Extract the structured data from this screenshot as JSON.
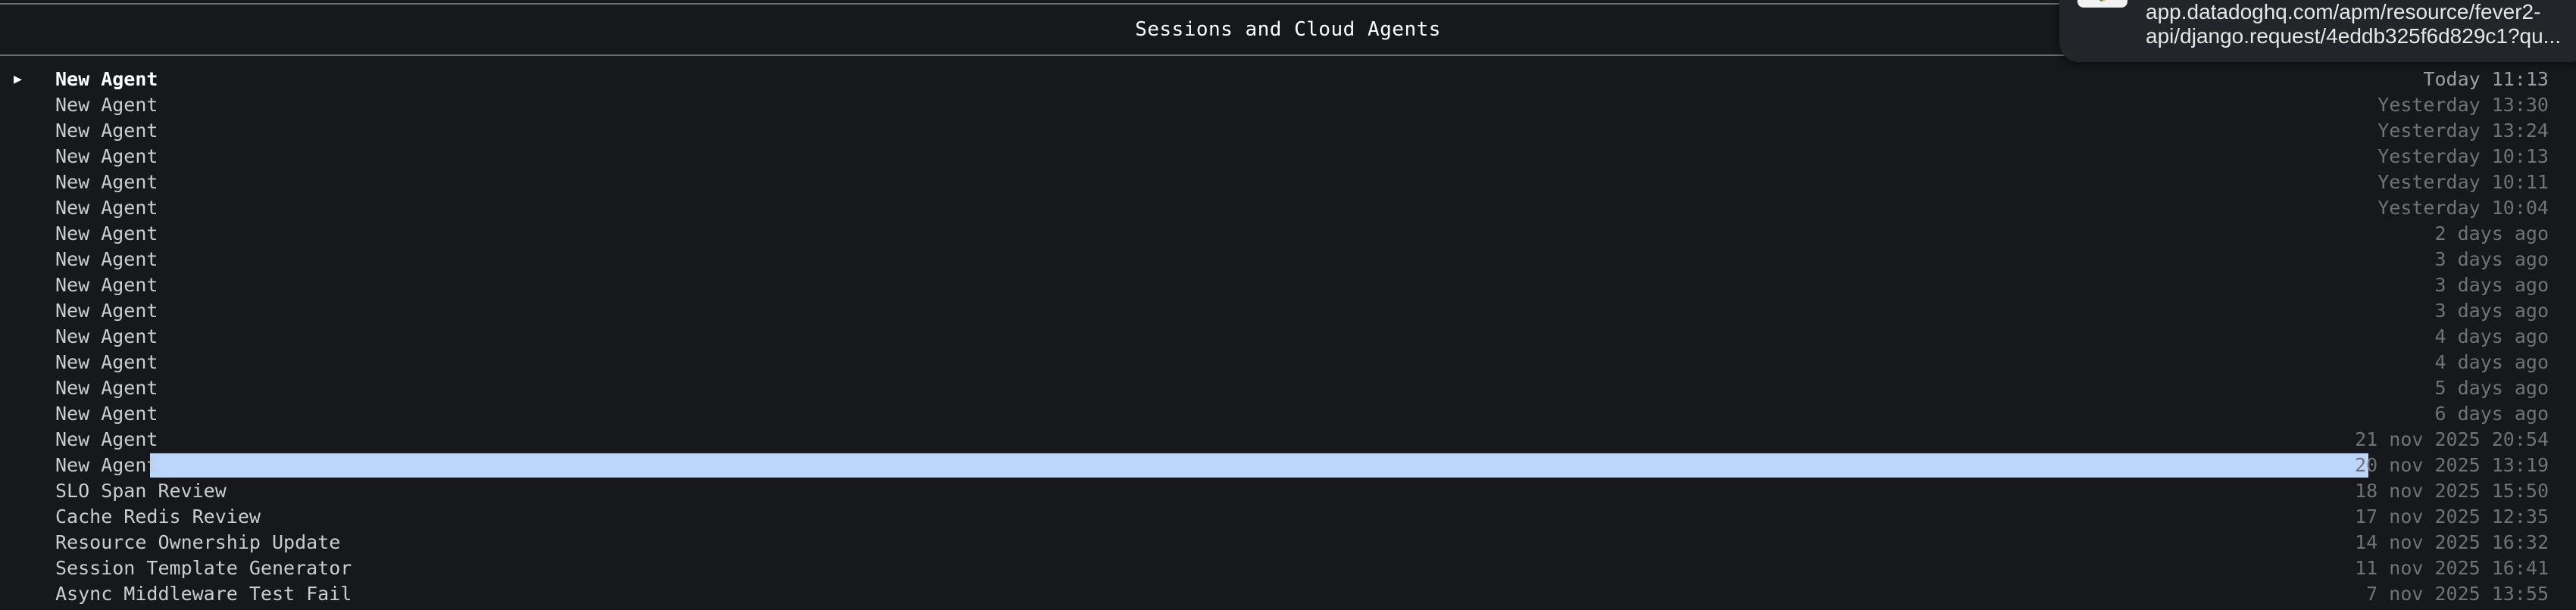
{
  "window": {
    "title": "Sessions and Cloud Agents"
  },
  "sessions": [
    {
      "name": "New Agent",
      "time": "Today 11:13",
      "active": true,
      "selected": false
    },
    {
      "name": "New Agent",
      "time": "Yesterday 13:30",
      "active": false,
      "selected": false
    },
    {
      "name": "New Agent",
      "time": "Yesterday 13:24",
      "active": false,
      "selected": false
    },
    {
      "name": "New Agent",
      "time": "Yesterday 10:13",
      "active": false,
      "selected": false
    },
    {
      "name": "New Agent",
      "time": "Yesterday 10:11",
      "active": false,
      "selected": false
    },
    {
      "name": "New Agent",
      "time": "Yesterday 10:04",
      "active": false,
      "selected": false
    },
    {
      "name": "New Agent",
      "time": "2 days ago",
      "active": false,
      "selected": false
    },
    {
      "name": "New Agent",
      "time": "3 days ago",
      "active": false,
      "selected": false
    },
    {
      "name": "New Agent",
      "time": "3 days ago",
      "active": false,
      "selected": false
    },
    {
      "name": "New Agent",
      "time": "3 days ago",
      "active": false,
      "selected": false
    },
    {
      "name": "New Agent",
      "time": "4 days ago",
      "active": false,
      "selected": false
    },
    {
      "name": "New Agent",
      "time": "4 days ago",
      "active": false,
      "selected": false
    },
    {
      "name": "New Agent",
      "time": "5 days ago",
      "active": false,
      "selected": false
    },
    {
      "name": "New Agent",
      "time": "6 days ago",
      "active": false,
      "selected": false
    },
    {
      "name": "New Agent",
      "time": "21 nov 2025 20:54",
      "active": false,
      "selected": false
    },
    {
      "name": "New Agent",
      "time": "20 nov 2025 13:19",
      "active": false,
      "selected": true
    },
    {
      "name": "SLO Span Review",
      "time": "18 nov 2025 15:50",
      "active": false,
      "selected": false
    },
    {
      "name": "Cache Redis Review",
      "time": "17 nov 2025 12:35",
      "active": false,
      "selected": false
    },
    {
      "name": "Resource Ownership Update",
      "time": "14 nov 2025 16:32",
      "active": false,
      "selected": false
    },
    {
      "name": "Session Template Generator",
      "time": "11 nov 2025 16:41",
      "active": false,
      "selected": false
    },
    {
      "name": "Async Middleware Test Fail",
      "time": "7 nov 2025 13:55",
      "active": false,
      "selected": false
    }
  ],
  "active_marker": "▶",
  "notification": {
    "line1": "app.datadoghq.com/apm/resource/fever2-",
    "line2": "api/django.request/4eddb325f6d829c1?qu...",
    "icon": "browser-app-icon"
  },
  "colors": {
    "background": "#16181c",
    "text": "#c9ccd1",
    "muted": "#6f7378",
    "selection": "#bcd5fb"
  }
}
